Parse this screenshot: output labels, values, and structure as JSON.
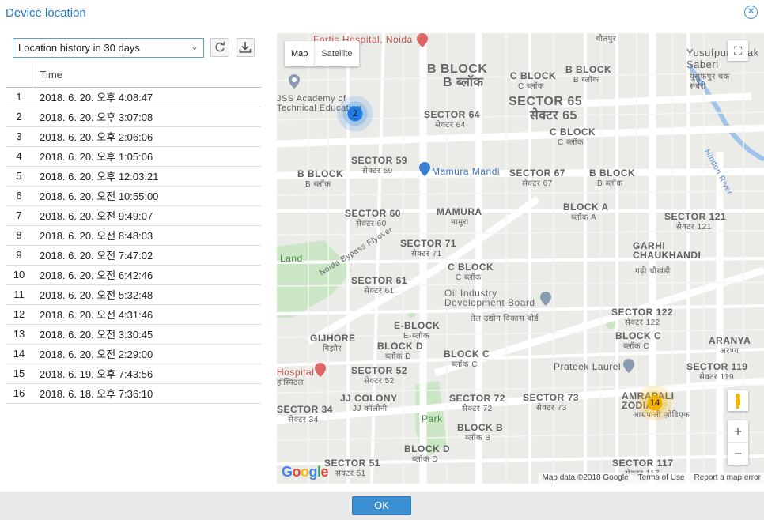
{
  "dialog": {
    "title": "Device location",
    "ok_label": "OK"
  },
  "controls": {
    "range_select": "Location history in 30 days"
  },
  "table": {
    "header_time": "Time",
    "rows": [
      {
        "n": "1",
        "time": "2018. 6. 20. 오후 4:08:47"
      },
      {
        "n": "2",
        "time": "2018. 6. 20. 오후 3:07:08"
      },
      {
        "n": "3",
        "time": "2018. 6. 20. 오후 2:06:06"
      },
      {
        "n": "4",
        "time": "2018. 6. 20. 오후 1:05:06"
      },
      {
        "n": "5",
        "time": "2018. 6. 20. 오후 12:03:21"
      },
      {
        "n": "6",
        "time": "2018. 6. 20. 오전 10:55:00"
      },
      {
        "n": "7",
        "time": "2018. 6. 20. 오전 9:49:07"
      },
      {
        "n": "8",
        "time": "2018. 6. 20. 오전 8:48:03"
      },
      {
        "n": "9",
        "time": "2018. 6. 20. 오전 7:47:02"
      },
      {
        "n": "10",
        "time": "2018. 6. 20. 오전 6:42:46"
      },
      {
        "n": "11",
        "time": "2018. 6. 20. 오전 5:32:48"
      },
      {
        "n": "12",
        "time": "2018. 6. 20. 오전 4:31:46"
      },
      {
        "n": "13",
        "time": "2018. 6. 20. 오전 3:30:45"
      },
      {
        "n": "14",
        "time": "2018. 6. 20. 오전 2:29:00"
      },
      {
        "n": "15",
        "time": "2018. 6. 19. 오후 7:43:56"
      },
      {
        "n": "16",
        "time": "2018. 6. 18. 오후 7:36:10"
      }
    ]
  },
  "map": {
    "type_map": "Map",
    "type_satellite": "Satellite",
    "cluster_blue": "2",
    "cluster_yellow": "14",
    "google_logo": "Google",
    "attribution": "Map data ©2018 Google",
    "terms": "Terms of Use",
    "report": "Report a map error",
    "labels": {
      "fortis": "Fortis Hospital, Noida",
      "b_block_top": "B BLOCK",
      "b_block_top_hi": "B ब्लॉक",
      "c_block_top": "C BLOCK",
      "c_block_top_hi": "C ब्लॉक",
      "b_block_tr": "B BLOCK",
      "b_block_tr_hi": "B ब्लॉक",
      "sector64": "SECTOR 64",
      "sector64_hi": "सेक्टर 64",
      "sector65": "SECTOR 65",
      "sector65_hi": "सेक्टर 65",
      "c_block_65": "C BLOCK",
      "c_block_65_hi": "C ब्लॉक",
      "jss": "JSS Academy of Technical Education",
      "sector59": "SECTOR 59",
      "sector59_hi": "सेक्टर 59",
      "mamura_mandi": "Mamura Mandi",
      "sector67": "SECTOR 67",
      "sector67_hi": "सेक्टर 67",
      "b_block_67": "B BLOCK",
      "b_block_67_hi": "B ब्लॉक",
      "b_block_59": "B BLOCK",
      "b_block_59_hi": "B ब्लॉक",
      "sector60": "SECTOR 60",
      "sector60_hi": "सेक्टर 60",
      "mamura": "MAMURA",
      "mamura_hi": "मामूरा",
      "block_a": "BLOCK A",
      "block_a_hi": "ब्लॉक A",
      "sector121": "SECTOR 121",
      "sector121_hi": "सेक्टर 121",
      "sector71": "SECTOR 71",
      "sector71_hi": "सेक्टर 71",
      "garhi": "GARHI CHAUKHANDI",
      "garhi_hi": "गढ़ी चौखंडी",
      "c_block_71": "C BLOCK",
      "c_block_71_hi": "C ब्लॉक",
      "land": "Land",
      "flyover": "Noida Bypass Flyover",
      "sector61": "SECTOR 61",
      "sector61_hi": "सेक्टर 61",
      "oil_board": "Oil Industry Development Board",
      "oil_board_hi": "तेल उद्योग विकास बोर्ड",
      "sector122": "SECTOR 122",
      "sector122_hi": "सेक्टर 122",
      "e_block": "E-BLOCK",
      "e_block_hi": "E-ब्लॉक",
      "gijhore": "GIJHORE",
      "gijhore_hi": "गिझौर",
      "block_d": "BLOCK D",
      "block_d_hi": "ब्लॉक D",
      "block_c": "BLOCK C",
      "block_c_hi": "ब्लॉक C",
      "block_c_122": "BLOCK C",
      "block_c_122_hi": "ब्लॉक C",
      "aranya": "ARANYA",
      "aranya_hi": "अरण्य",
      "hospital": "Hospital",
      "hospital_hi": "हॉस्पिटल",
      "sector52": "SECTOR 52",
      "sector52_hi": "सेक्टर 52",
      "prateek": "Prateek Laurel",
      "sector119": "SECTOR 119",
      "sector119_hi": "सेक्टर 119",
      "jj_colony": "JJ COLONY",
      "jj_colony_hi": "JJ कॉलोनी",
      "sector72": "SECTOR 72",
      "sector72_hi": "सेक्टर 72",
      "sector73": "SECTOR 73",
      "sector73_hi": "सेक्टर 73",
      "amrapali": "AMRAPALI ZODIAC",
      "amrapali_hi": "आम्रपाली ज़ोडिएक",
      "sector34": "SECTOR 34",
      "sector34_hi": "सेक्टर 34",
      "park": "Park",
      "block_b": "BLOCK B",
      "block_b_hi": "ब्लॉक B",
      "block_d2": "BLOCK D",
      "block_d2_hi": "ब्लॉक D",
      "sector51": "SECTOR 51",
      "sector51_hi": "सेक्टर 51",
      "sector117": "SECTOR 117",
      "sector117_hi": "सेक्टर 117",
      "yusufpur": "Yusufpur Chak Saberi",
      "yusufpur_hi": "यूसुफपुर चक सबेरी",
      "chauparpur": "चौतपुर",
      "hindon": "Hindon River"
    }
  }
}
